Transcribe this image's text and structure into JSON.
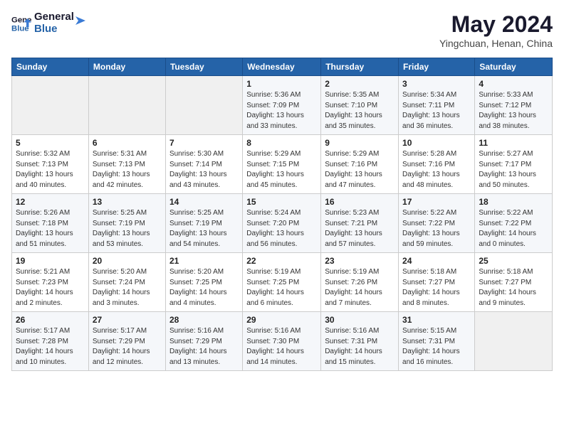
{
  "header": {
    "logo_line1": "General",
    "logo_line2": "Blue",
    "title": "May 2024",
    "subtitle": "Yingchuan, Henan, China"
  },
  "weekdays": [
    "Sunday",
    "Monday",
    "Tuesday",
    "Wednesday",
    "Thursday",
    "Friday",
    "Saturday"
  ],
  "weeks": [
    [
      {
        "day": "",
        "info": ""
      },
      {
        "day": "",
        "info": ""
      },
      {
        "day": "",
        "info": ""
      },
      {
        "day": "1",
        "info": "Sunrise: 5:36 AM\nSunset: 7:09 PM\nDaylight: 13 hours\nand 33 minutes."
      },
      {
        "day": "2",
        "info": "Sunrise: 5:35 AM\nSunset: 7:10 PM\nDaylight: 13 hours\nand 35 minutes."
      },
      {
        "day": "3",
        "info": "Sunrise: 5:34 AM\nSunset: 7:11 PM\nDaylight: 13 hours\nand 36 minutes."
      },
      {
        "day": "4",
        "info": "Sunrise: 5:33 AM\nSunset: 7:12 PM\nDaylight: 13 hours\nand 38 minutes."
      }
    ],
    [
      {
        "day": "5",
        "info": "Sunrise: 5:32 AM\nSunset: 7:13 PM\nDaylight: 13 hours\nand 40 minutes."
      },
      {
        "day": "6",
        "info": "Sunrise: 5:31 AM\nSunset: 7:13 PM\nDaylight: 13 hours\nand 42 minutes."
      },
      {
        "day": "7",
        "info": "Sunrise: 5:30 AM\nSunset: 7:14 PM\nDaylight: 13 hours\nand 43 minutes."
      },
      {
        "day": "8",
        "info": "Sunrise: 5:29 AM\nSunset: 7:15 PM\nDaylight: 13 hours\nand 45 minutes."
      },
      {
        "day": "9",
        "info": "Sunrise: 5:29 AM\nSunset: 7:16 PM\nDaylight: 13 hours\nand 47 minutes."
      },
      {
        "day": "10",
        "info": "Sunrise: 5:28 AM\nSunset: 7:16 PM\nDaylight: 13 hours\nand 48 minutes."
      },
      {
        "day": "11",
        "info": "Sunrise: 5:27 AM\nSunset: 7:17 PM\nDaylight: 13 hours\nand 50 minutes."
      }
    ],
    [
      {
        "day": "12",
        "info": "Sunrise: 5:26 AM\nSunset: 7:18 PM\nDaylight: 13 hours\nand 51 minutes."
      },
      {
        "day": "13",
        "info": "Sunrise: 5:25 AM\nSunset: 7:19 PM\nDaylight: 13 hours\nand 53 minutes."
      },
      {
        "day": "14",
        "info": "Sunrise: 5:25 AM\nSunset: 7:19 PM\nDaylight: 13 hours\nand 54 minutes."
      },
      {
        "day": "15",
        "info": "Sunrise: 5:24 AM\nSunset: 7:20 PM\nDaylight: 13 hours\nand 56 minutes."
      },
      {
        "day": "16",
        "info": "Sunrise: 5:23 AM\nSunset: 7:21 PM\nDaylight: 13 hours\nand 57 minutes."
      },
      {
        "day": "17",
        "info": "Sunrise: 5:22 AM\nSunset: 7:22 PM\nDaylight: 13 hours\nand 59 minutes."
      },
      {
        "day": "18",
        "info": "Sunrise: 5:22 AM\nSunset: 7:22 PM\nDaylight: 14 hours\nand 0 minutes."
      }
    ],
    [
      {
        "day": "19",
        "info": "Sunrise: 5:21 AM\nSunset: 7:23 PM\nDaylight: 14 hours\nand 2 minutes."
      },
      {
        "day": "20",
        "info": "Sunrise: 5:20 AM\nSunset: 7:24 PM\nDaylight: 14 hours\nand 3 minutes."
      },
      {
        "day": "21",
        "info": "Sunrise: 5:20 AM\nSunset: 7:25 PM\nDaylight: 14 hours\nand 4 minutes."
      },
      {
        "day": "22",
        "info": "Sunrise: 5:19 AM\nSunset: 7:25 PM\nDaylight: 14 hours\nand 6 minutes."
      },
      {
        "day": "23",
        "info": "Sunrise: 5:19 AM\nSunset: 7:26 PM\nDaylight: 14 hours\nand 7 minutes."
      },
      {
        "day": "24",
        "info": "Sunrise: 5:18 AM\nSunset: 7:27 PM\nDaylight: 14 hours\nand 8 minutes."
      },
      {
        "day": "25",
        "info": "Sunrise: 5:18 AM\nSunset: 7:27 PM\nDaylight: 14 hours\nand 9 minutes."
      }
    ],
    [
      {
        "day": "26",
        "info": "Sunrise: 5:17 AM\nSunset: 7:28 PM\nDaylight: 14 hours\nand 10 minutes."
      },
      {
        "day": "27",
        "info": "Sunrise: 5:17 AM\nSunset: 7:29 PM\nDaylight: 14 hours\nand 12 minutes."
      },
      {
        "day": "28",
        "info": "Sunrise: 5:16 AM\nSunset: 7:29 PM\nDaylight: 14 hours\nand 13 minutes."
      },
      {
        "day": "29",
        "info": "Sunrise: 5:16 AM\nSunset: 7:30 PM\nDaylight: 14 hours\nand 14 minutes."
      },
      {
        "day": "30",
        "info": "Sunrise: 5:16 AM\nSunset: 7:31 PM\nDaylight: 14 hours\nand 15 minutes."
      },
      {
        "day": "31",
        "info": "Sunrise: 5:15 AM\nSunset: 7:31 PM\nDaylight: 14 hours\nand 16 minutes."
      },
      {
        "day": "",
        "info": ""
      }
    ]
  ]
}
